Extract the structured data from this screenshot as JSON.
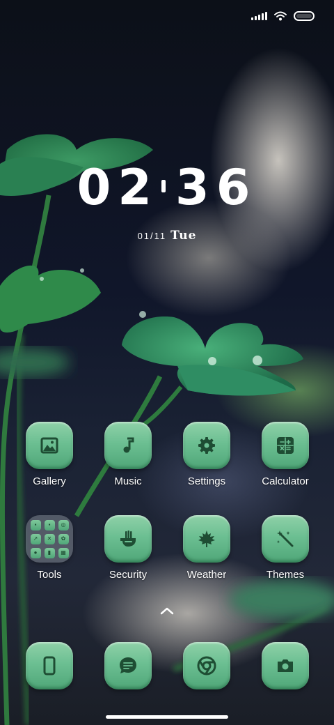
{
  "clock": {
    "time_hours": "02",
    "time_minutes": "36",
    "date": "01/11",
    "weekday": "Tue"
  },
  "status_bar": {
    "signal_icon": "signal-icon",
    "wifi_icon": "wifi-icon",
    "battery_icon": "battery-icon"
  },
  "apps": [
    {
      "label": "Gallery",
      "icon": "image-icon"
    },
    {
      "label": "Music",
      "icon": "music-note-icon"
    },
    {
      "label": "Settings",
      "icon": "gear-icon"
    },
    {
      "label": "Calculator",
      "icon": "calculator-icon"
    },
    {
      "label": "Tools",
      "icon": "folder-icon"
    },
    {
      "label": "Security",
      "icon": "shield-hand-icon"
    },
    {
      "label": "Weather",
      "icon": "maple-leaf-icon"
    },
    {
      "label": "Themes",
      "icon": "magic-wand-icon"
    }
  ],
  "dock": [
    {
      "icon": "phone-icon"
    },
    {
      "icon": "message-icon"
    },
    {
      "icon": "chrome-icon"
    },
    {
      "icon": "camera-icon"
    }
  ],
  "colors": {
    "icon_green": "#6cbf92",
    "icon_glyph": "#1e4d33"
  }
}
